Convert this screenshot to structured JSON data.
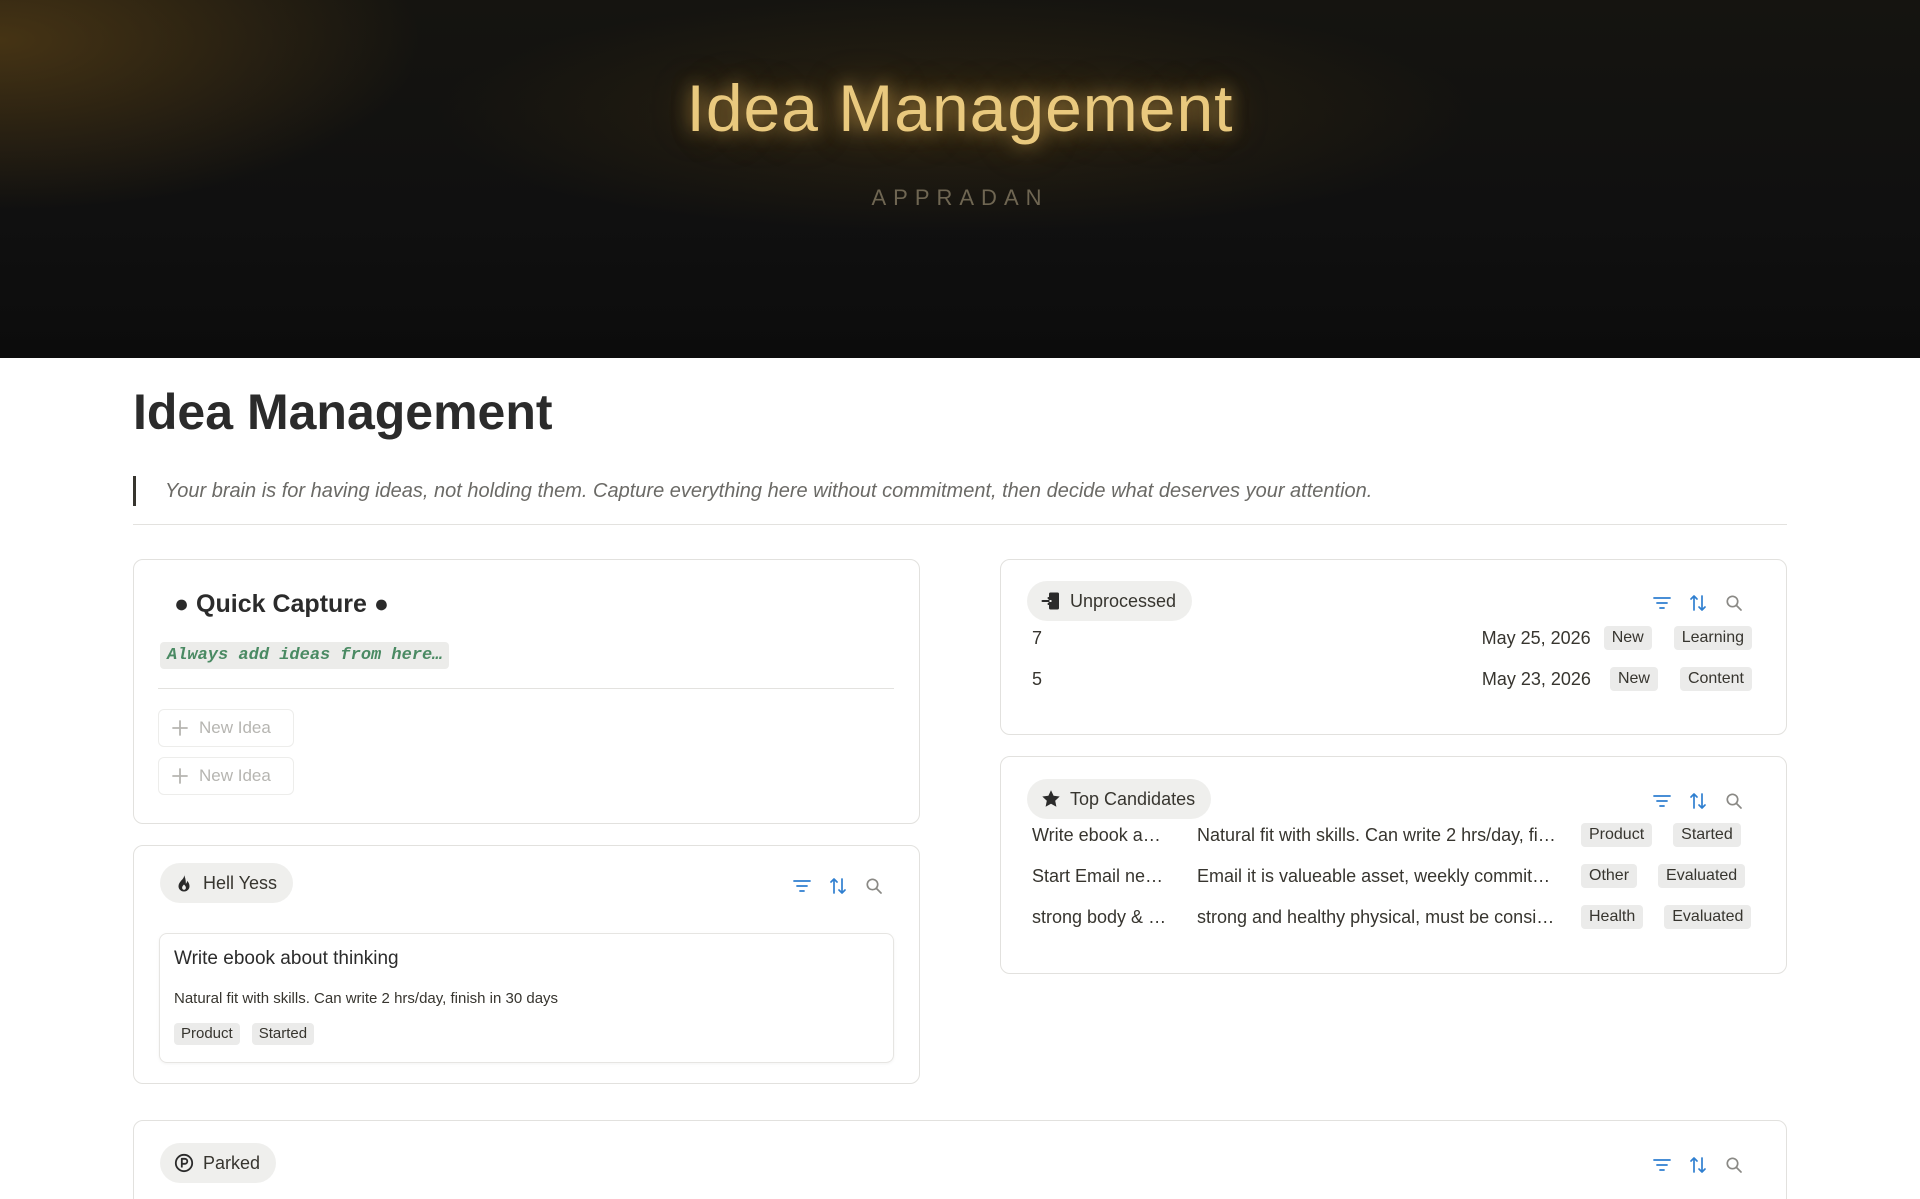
{
  "banner": {
    "title": "Idea Management",
    "subtitle": "APPRADAN"
  },
  "page": {
    "title": "Idea Management",
    "quote": "Your brain is for having ideas, not holding them. Capture everything here without commitment, then decide what deserves your attention."
  },
  "quick_capture": {
    "title": "● Quick Capture ●",
    "code_text": "Always add ideas from here…",
    "buttons": [
      {
        "label": "New Idea"
      },
      {
        "label": "New Idea"
      }
    ]
  },
  "hell_yess": {
    "label": "Hell Yess",
    "icon": "fire-icon",
    "cards": [
      {
        "title": "Write ebook about thinking",
        "description": "Natural fit with skills. Can write 2 hrs/day, finish in 30 days",
        "tags": [
          "Product",
          "Started"
        ]
      }
    ]
  },
  "unprocessed": {
    "label": "Unprocessed",
    "icon": "inbox-enter-icon",
    "rows": [
      {
        "score": "7",
        "date": "May 25, 2026",
        "status": "New",
        "category": "Learning"
      },
      {
        "score": "5",
        "date": "May 23, 2026",
        "status": "New",
        "category": "Content"
      }
    ]
  },
  "top_candidates": {
    "label": "Top Candidates",
    "icon": "star-icon",
    "rows": [
      {
        "name": "Write ebook a…",
        "notes": "Natural fit with skills. Can write 2 hrs/day, fi…",
        "category": "Product",
        "status": "Started"
      },
      {
        "name": "Start Email ne…",
        "notes": "Email it is valueable asset, weekly commit…",
        "category": "Other",
        "status": "Evaluated"
      },
      {
        "name": "strong body & …",
        "notes": "strong and healthy physical, must be consi…",
        "category": "Health",
        "status": "Evaluated"
      }
    ]
  },
  "parked": {
    "label": "Parked",
    "icon": "parking-icon"
  },
  "tools": {
    "filter_icon": "filter-icon",
    "sort_icon": "sort-icon",
    "search_icon": "search-icon"
  },
  "colors": {
    "accent_blue": "#2f7fd0",
    "code_green": "#4a8a63",
    "banner_gold": "#e9c97e"
  }
}
